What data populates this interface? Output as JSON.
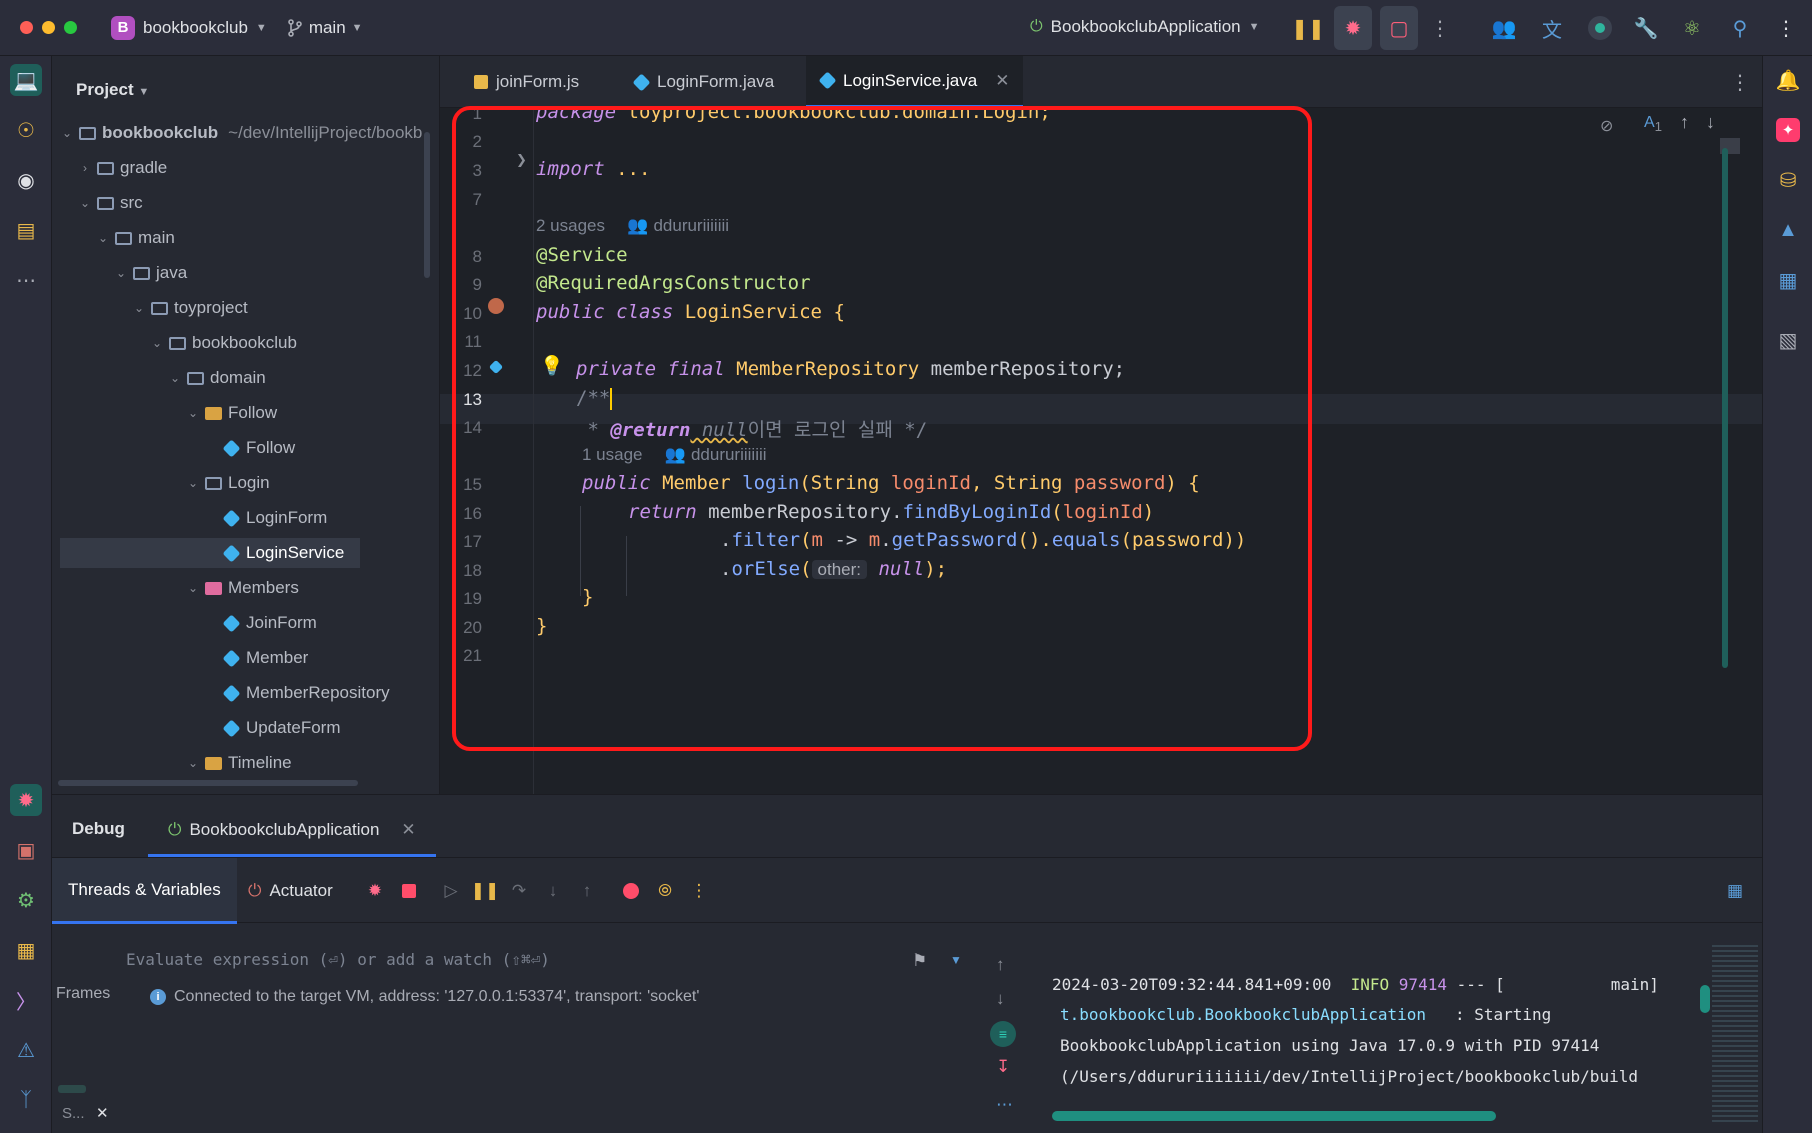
{
  "titlebar": {
    "project_initial": "B",
    "project_name": "bookbookclub",
    "branch": "main",
    "run_config": "BookbookclubApplication"
  },
  "project_panel": {
    "title": "Project",
    "tree": [
      {
        "label": "bookbookclub",
        "path": "~/dev/IntellijProject/bookb",
        "depth": 0,
        "type": "root",
        "expanded": true
      },
      {
        "label": "gradle",
        "depth": 1,
        "type": "folder",
        "expanded": false
      },
      {
        "label": "src",
        "depth": 1,
        "type": "folder",
        "expanded": true
      },
      {
        "label": "main",
        "depth": 2,
        "type": "folder",
        "expanded": true
      },
      {
        "label": "java",
        "depth": 3,
        "type": "folder",
        "expanded": true
      },
      {
        "label": "toyproject",
        "depth": 4,
        "type": "folder",
        "expanded": true
      },
      {
        "label": "bookbookclub",
        "depth": 5,
        "type": "folder",
        "expanded": true
      },
      {
        "label": "domain",
        "depth": 6,
        "type": "folder",
        "expanded": true
      },
      {
        "label": "Follow",
        "depth": 7,
        "type": "folder-yellow",
        "expanded": true
      },
      {
        "label": "Follow",
        "depth": 8,
        "type": "class"
      },
      {
        "label": "Login",
        "depth": 7,
        "type": "folder",
        "expanded": true
      },
      {
        "label": "LoginForm",
        "depth": 8,
        "type": "class"
      },
      {
        "label": "LoginService",
        "depth": 8,
        "type": "class",
        "selected": true
      },
      {
        "label": "Members",
        "depth": 7,
        "type": "folder-pink",
        "expanded": true
      },
      {
        "label": "JoinForm",
        "depth": 8,
        "type": "class"
      },
      {
        "label": "Member",
        "depth": 8,
        "type": "class"
      },
      {
        "label": "MemberRepository",
        "depth": 8,
        "type": "class"
      },
      {
        "label": "UpdateForm",
        "depth": 8,
        "type": "class"
      },
      {
        "label": "Timeline",
        "depth": 7,
        "type": "folder-yellow",
        "expanded": true
      }
    ]
  },
  "tabs": [
    {
      "label": "joinForm.js",
      "type": "js"
    },
    {
      "label": "LoginForm.java",
      "type": "class"
    },
    {
      "label": "LoginService.java",
      "type": "class",
      "active": true
    }
  ],
  "editor": {
    "line_numbers": [
      "1",
      "2",
      "3",
      "7",
      "8",
      "9",
      "10",
      "11",
      "12",
      "13",
      "14",
      "15",
      "16",
      "17",
      "18",
      "19",
      "20",
      "21"
    ],
    "inlay_usages_top": "2 usages",
    "inlay_author_top": "ddururiiiiiii",
    "inlay_usages_method": "1 usage",
    "inlay_author_method": "ddururiiiiiii",
    "inspection_count": "1",
    "code": {
      "l1_kw": "package",
      "l1_rest": " toyproject.bookbookclub.domain.Login;",
      "l3_kw": "import",
      "l3_rest": " ...",
      "l8": "@Service",
      "l9": "@RequiredArgsConstructor",
      "l10_kw": "public class",
      "l10_name": " LoginService",
      "l10_brace": " {",
      "l12_kw": "private final",
      "l12_type": " MemberRepository",
      "l12_rest": " memberRepository;",
      "l13": "/**",
      "l14_star": " * ",
      "l14_tag": "@return",
      "l14_null": " null",
      "l14_text": "이면 로그인 실패 */",
      "l15_kw": "public",
      "l15_type": " Member",
      "l15_fn": " login",
      "l15_p1": "(String ",
      "l15_v1": "loginId",
      "l15_p2": ", String ",
      "l15_v2": "password",
      "l15_end": ") {",
      "l16_kw": "return",
      "l16_obj": " memberRepository.",
      "l16_fn": "findByLoginId",
      "l16_open": "(",
      "l16_arg": "loginId",
      "l16_close": ")",
      "l17_dot": ".",
      "l17_fn": "filter",
      "l17_open": "(",
      "l17_m": "m",
      "l17_arrow": " -> ",
      "l17_m2": "m",
      "l17_dot2": ".",
      "l17_fn2": "getPassword",
      "l17_mid": "().",
      "l17_fn3": "equals",
      "l17_open2": "(",
      "l17_arg": "password",
      "l17_close": "))",
      "l18_dot": ".",
      "l18_fn": "orElse",
      "l18_open": "(",
      "l18_hint": "other:",
      "l18_null": " null",
      "l18_end": ");",
      "l19": "}",
      "l20": "}"
    }
  },
  "debug": {
    "title": "Debug",
    "session_tab": "BookbookclubApplication",
    "threads_tab": "Threads & Variables",
    "actuator_tab": "Actuator",
    "evaluate_placeholder": "Evaluate expression (⏎) or add a watch (⇧⌘⏎)",
    "frames_label": "Frames",
    "connected_msg": "Connected to the target VM, address: '127.0.0.1:53374', transport: 'socket'",
    "collapsed_label": "S...",
    "console": {
      "line1_time": "2024-03-20T09:32:44.841+09:00",
      "line1_level": "INFO",
      "line1_pid": "97414",
      "line1_rest": " --- [           main]",
      "line2_logger": "t.bookbookclub.BookbookclubApplication",
      "line2_rest": "   : Starting",
      "line3": "BookbookclubApplication using Java 17.0.9 with PID 97414",
      "line4": "(/Users/ddururiiiiiii/dev/IntellijProject/bookbookclub/build"
    }
  },
  "colors": {
    "accent": "#3574f0",
    "highlight_box": "#ff1a1a",
    "keyword": "#c792ea",
    "type": "#ffcb6b",
    "annotation": "#c3e88d"
  }
}
